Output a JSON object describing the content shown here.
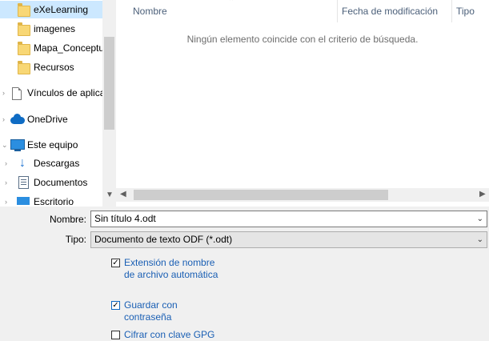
{
  "nav": {
    "items": [
      {
        "label": "eXeLearning",
        "icon": "folder-icon",
        "selected": true
      },
      {
        "label": "imagenes",
        "icon": "folder-icon"
      },
      {
        "label": "Mapa_Conceptu",
        "icon": "folder-icon"
      },
      {
        "label": "Recursos",
        "icon": "folder-icon"
      },
      {
        "label": "Vínculos de aplica",
        "icon": "document-icon"
      },
      {
        "label": "OneDrive",
        "icon": "cloud-icon"
      },
      {
        "label": "Este equipo",
        "icon": "computer-icon"
      },
      {
        "label": "Descargas",
        "icon": "download-icon"
      },
      {
        "label": "Documentos",
        "icon": "documents-icon"
      },
      {
        "label": "Escritorio",
        "icon": "desktop-icon"
      }
    ]
  },
  "list": {
    "columns": [
      "Nombre",
      "Fecha de modificación",
      "Tipo"
    ],
    "empty_message": "Ningún elemento coincide con el criterio de búsqueda."
  },
  "form": {
    "name_label": "Nombre:",
    "name_value": "Sin título 4.odt",
    "type_label": "Tipo:",
    "type_value": "Documento de texto ODF (*.odt)"
  },
  "options": {
    "auto_ext_line1": "Extensión de nombre",
    "auto_ext_line2": "de archivo automática",
    "auto_ext_checked": true,
    "password_line1": "Guardar con",
    "password_line2": "contraseña",
    "password_checked": true,
    "gpg_label": "Cifrar con clave GPG",
    "gpg_checked": false
  },
  "colors": {
    "selection": "#cce8ff",
    "link_text": "#1a5fb4",
    "header_text": "#4c607a"
  }
}
